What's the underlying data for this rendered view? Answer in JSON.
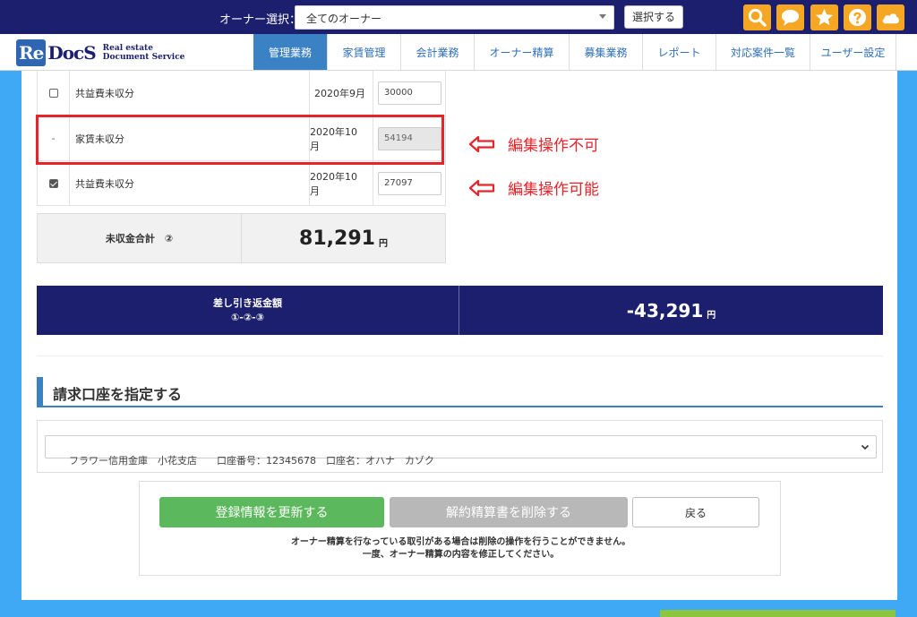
{
  "topbar": {
    "owner_label": "オーナー選択：",
    "owner_select_value": "全てのオーナー",
    "select_button": "選択する",
    "icons": [
      "search-icon",
      "chat-icon",
      "star-icon",
      "help-icon",
      "cloud-icon"
    ],
    "icon_color": "#f5a623"
  },
  "header": {
    "logo": {
      "re": "Re",
      "docs": "DocS",
      "sub_line1": "Real estate",
      "sub_line2": "Document Service"
    },
    "nav": [
      {
        "label": "管理業務",
        "active": true
      },
      {
        "label": "家賃管理",
        "active": false
      },
      {
        "label": "会計業務",
        "active": false
      },
      {
        "label": "オーナー精算",
        "active": false
      },
      {
        "label": "募集業務",
        "active": false
      },
      {
        "label": "レポート",
        "active": false
      },
      {
        "label": "対応案件一覧",
        "active": false
      },
      {
        "label": "ユーザー設定",
        "active": false
      }
    ]
  },
  "rows": [
    {
      "check": "unchecked",
      "label": "共益費未収分",
      "month": "2020年9月",
      "amount": "30000"
    },
    {
      "check": "-",
      "label": "家賃未収分",
      "month": "2020年10月",
      "amount": "54194"
    },
    {
      "check": "checked",
      "label": "共益費未収分",
      "month": "2020年10月",
      "amount": "27097"
    }
  ],
  "annotations": {
    "not_editable": "編集操作不可",
    "editable": "編集操作可能",
    "color": "#e8232a"
  },
  "total": {
    "label": "未収金合計　②",
    "value": "81,291",
    "unit": "円"
  },
  "difference": {
    "label_line1": "差し引き返金額",
    "label_line2": "①-②-③",
    "value": "-43,291",
    "unit": "円",
    "bg_color": "#1b1f6e"
  },
  "billing_section": {
    "title": "請求口座を指定する",
    "account_select_value": "フラワー信用金庫　小花支店　　口座番号：12345678　口座名：オハナ　カゾク"
  },
  "actions": {
    "update_button": "登録情報を更新する",
    "delete_button": "解約精算書を削除する",
    "back_button": "戻る",
    "notice_line1": "オーナー精算を行なっている取引がある場合は削除の操作を行うことができません。",
    "notice_line2": "一度、オーナー精算の内容を修正してください。"
  }
}
